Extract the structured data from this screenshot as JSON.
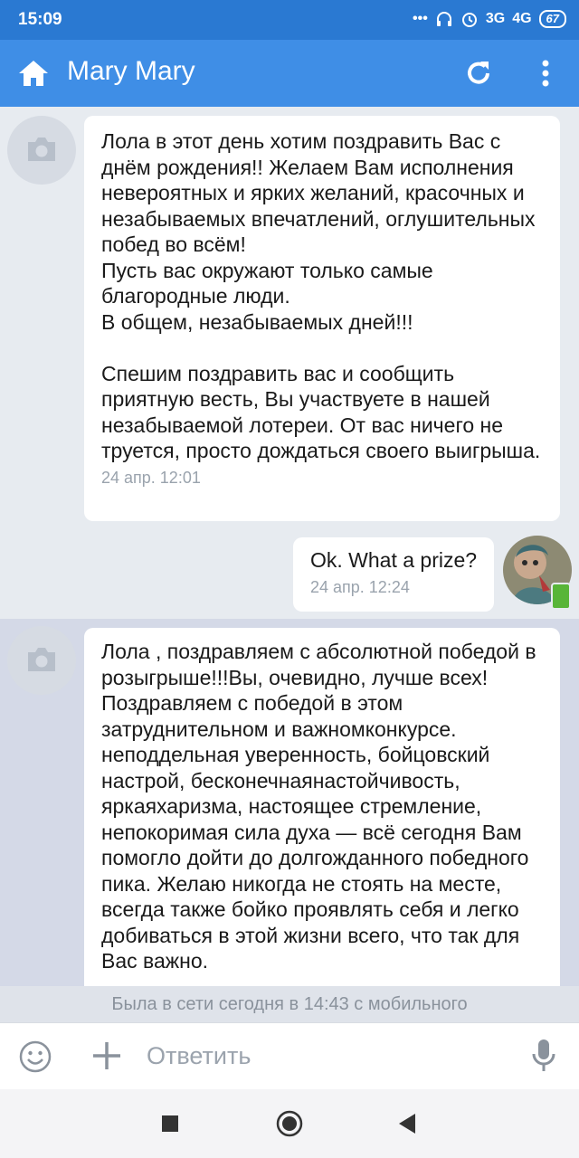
{
  "status_bar": {
    "time": "15:09",
    "signal_3g": "3G",
    "signal_4g": "4G",
    "battery": "67"
  },
  "header": {
    "title": "Mary Mary"
  },
  "messages": [
    {
      "direction": "incoming",
      "text": "Лола в этот день хотим поздравить Вас с днём рождения!! Желаем Вам исполнения невероятных и ярких желаний, красочных и незабываемых впечатлений, оглушительных побед во всём!\nПусть вас окружают только самые благородные люди.\nВ общем, незабываемых дней!!!\n\nСпешим поздравить вас и сообщить приятную весть, Вы участвуете в нашей незабываемой лотереи. От вас ничего не труется, просто дождаться своего выигрыша.",
      "time": "24 апр. 12:01"
    },
    {
      "direction": "outgoing",
      "text": "Ok. What a prize?",
      "time": "24 апр. 12:24"
    },
    {
      "direction": "incoming",
      "text": "Лола , поздравляем с абсолютной победой в розыгрыше!!!Вы, очевидно, лучше всех! Поздравляем с победой в этом затруднительном и важномконкурсе. неподдельная уверенность, бойцовский настрой, бесконечнаянастойчивость, яркаяхаризма, настоящее стремление, непокоримая сила духа — всё сегодня Вам помогло дойти до долгожданного победного пика. Желаю никогда не стоять на месте, всегда также бойко проявлять себя и легко добиваться в этой жизни всего, что так для Вас важно.",
      "time": ""
    }
  ],
  "last_seen": "Была в сети сегодня в 14:43 с мобильного",
  "composer": {
    "placeholder": "Ответить"
  },
  "colors": {
    "status_bar": "#2a79d2",
    "app_bar": "#3f8ee6",
    "unread_row": "#d4d9e7"
  }
}
